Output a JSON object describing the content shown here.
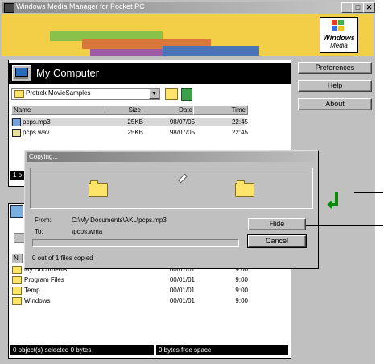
{
  "window": {
    "title": "Windows Media Manager for Pocket PC",
    "min_label": "_",
    "max_label": "□",
    "close_label": "✕"
  },
  "banner": {
    "logo_line1": "Windows",
    "logo_line2": "Media"
  },
  "my_computer": {
    "title": "My Computer",
    "folder": "Protrek MovieSamples",
    "columns": [
      "Name",
      "Size",
      "Date",
      "Time"
    ],
    "files": [
      {
        "name": "pcps.mp3",
        "size": "25KB",
        "date": "98/07/05",
        "time": "22:45"
      },
      {
        "name": "pcps.wav",
        "size": "25KB",
        "date": "98/07/05",
        "time": "22:45"
      }
    ],
    "status_visible": "1 o"
  },
  "side_buttons": {
    "preferences": "Preferences",
    "help": "Help",
    "about": "About"
  },
  "device": {
    "columns_visible": "N",
    "rows": [
      {
        "name": "My Documents",
        "date": "00/01/01",
        "time": "9:00"
      },
      {
        "name": "Program Files",
        "date": "00/01/01",
        "time": "9:00"
      },
      {
        "name": "Temp",
        "date": "00/01/01",
        "time": "9:00"
      },
      {
        "name": "Windows",
        "date": "00/01/01",
        "time": "9:00"
      }
    ],
    "status_left": "0 object(s) selected  0 bytes",
    "status_right": "0 bytes free space"
  },
  "copy_dialog": {
    "title": "Copying...",
    "from_label": "From:",
    "from_value": "C:\\My Documents\\AKL\\pcps.mp3",
    "to_label": "To:",
    "to_value": "\\pcps.wma",
    "hide_label": "Hide",
    "cancel_label": "Cancel",
    "progress": 0,
    "status": "0 out of 1 files copied"
  },
  "colors": {
    "banner_bg": "#f2cf46",
    "status_bg": "#000000",
    "window_bg": "#c0c0c0",
    "arrow": "#0a8a0a"
  }
}
